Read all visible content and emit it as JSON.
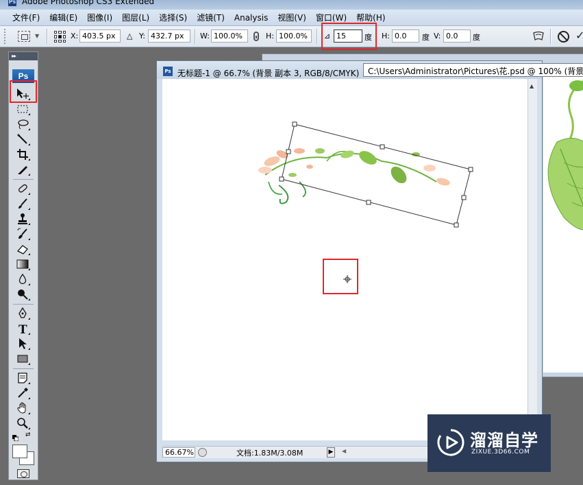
{
  "app": {
    "title": "Adobe Photoshop CS3 Extended",
    "logo": "Ps"
  },
  "menu": [
    "文件(F)",
    "编辑(E)",
    "图像(I)",
    "图层(L)",
    "选择(S)",
    "滤镜(T)",
    "Analysis",
    "视图(V)",
    "窗口(W)",
    "帮助(H)"
  ],
  "options": {
    "x_label": "X:",
    "x_value": "403.5 px",
    "y_label": "Y:",
    "y_value": "432.7 px",
    "w_label": "W:",
    "w_value": "100.0%",
    "h_label": "H:",
    "h_value": "100.0%",
    "rotate_value": "15",
    "rotate_unit": "度",
    "hskew_label": "H:",
    "hskew_value": "0.0",
    "hskew_unit": "度",
    "vskew_label": "V:",
    "vskew_value": "0.0",
    "vskew_unit": "度"
  },
  "tools": {
    "header": "▸▸",
    "active": "move-tool",
    "items": [
      "move-tool",
      "marquee-tool",
      "lasso-tool",
      "magic-wand-tool",
      "crop-tool",
      "slice-tool",
      "healing-brush-tool",
      "brush-tool",
      "clone-stamp-tool",
      "history-brush-tool",
      "eraser-tool",
      "gradient-tool",
      "blur-tool",
      "dodge-tool",
      "pen-tool",
      "type-tool",
      "path-selection-tool",
      "shape-tool",
      "notes-tool",
      "eyedropper-tool",
      "hand-tool",
      "zoom-tool"
    ],
    "foreground_color": "#ffffff",
    "background_color": "#ffffff"
  },
  "document": {
    "title": "无标题-1 @ 66.7% (背景 副本 3, RGB/8/CMYK)",
    "tooltip_path": "C:\\Users\\Administrator\\Pictures\\花.psd @ 100% (背景 副",
    "zoom": "66.67%",
    "doc_size": "文档:1.83M/3.08M",
    "transform_angle_deg": 15
  },
  "watermark": {
    "title": "溜溜自学",
    "subtitle": "ZIXUE.3D66.COM"
  },
  "colors": {
    "highlight": "#e3262a",
    "ps_blue": "#2f79c6",
    "watermark_bg": "#2b3a57"
  }
}
